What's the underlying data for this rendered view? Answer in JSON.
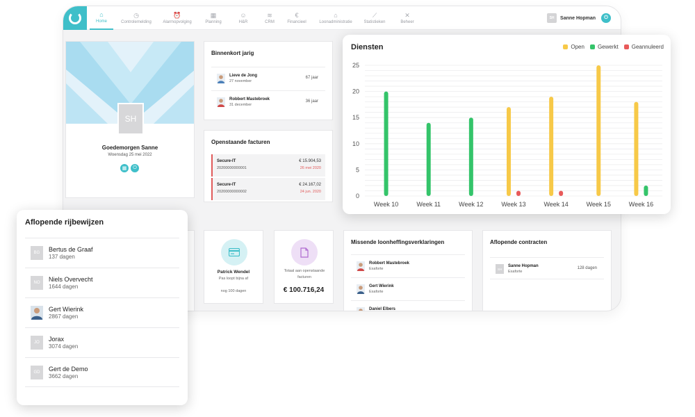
{
  "app": {
    "user_initials": "SH",
    "user_name": "Sanne Hopman",
    "accent_color": "#3fbfc9"
  },
  "nav": [
    {
      "label": "Home",
      "icon": "home-icon",
      "glyph": "⌂",
      "active": true
    },
    {
      "label": "Controlemelding",
      "icon": "clock-icon",
      "glyph": "◷"
    },
    {
      "label": "Alarmopvolging",
      "icon": "alarm-icon",
      "glyph": "⏰"
    },
    {
      "label": "Planning",
      "icon": "calendar-icon",
      "glyph": "▦"
    },
    {
      "label": "H&R",
      "icon": "people-icon",
      "glyph": "☺"
    },
    {
      "label": "CRM",
      "icon": "handshake-icon",
      "glyph": "≋"
    },
    {
      "label": "Financieel",
      "icon": "euro-icon",
      "glyph": "€"
    },
    {
      "label": "Loonadministratie",
      "icon": "bank-icon",
      "glyph": "⌂"
    },
    {
      "label": "Statistieken",
      "icon": "chart-icon",
      "glyph": "⟋"
    },
    {
      "label": "Beheer",
      "icon": "tools-icon",
      "glyph": "✕"
    }
  ],
  "welcome": {
    "initials": "SH",
    "greeting": "Goedemorgen Sanne",
    "date": "Woensdag 25 mei 2022"
  },
  "birthdays": {
    "title": "Binnenkort jarig",
    "items": [
      {
        "name": "Lieve de Jong",
        "date": "27 november",
        "age": "67 jaar"
      },
      {
        "name": "Robbert Mastebroek",
        "date": "31 december",
        "age": "36 jaar"
      }
    ]
  },
  "invoices": {
    "title": "Openstaande facturen",
    "items": [
      {
        "company": "Secure-IT",
        "number": "20200000000001",
        "amount": "€ 15.904,53",
        "due": "26 mei 2020"
      },
      {
        "company": "Secure-IT",
        "number": "20200000000002",
        "amount": "€ 24.167,02",
        "due": "24 jun. 2020"
      }
    ]
  },
  "pass_card": {
    "name": "Patrick Wendel",
    "line1": "Pas loopt bijna af",
    "line2": "nog 100 dagen"
  },
  "total_card": {
    "description": "Totaal aan openstaande facturen",
    "amount": "€ 100.716,24"
  },
  "missing": {
    "title": "Missende loonheffingsverklaringen",
    "items": [
      {
        "name": "Robbert Mastebroek",
        "org": "Exaforte"
      },
      {
        "name": "Gert Wierink",
        "org": "Exaforte"
      },
      {
        "name": "Daniel Elbers",
        "org": ""
      }
    ]
  },
  "contracts": {
    "title": "Aflopende contracten",
    "items": [
      {
        "initials": "SH",
        "name": "Sanne Hopman",
        "org": "Exaforte",
        "days": "128 dagen"
      }
    ]
  },
  "licenses": {
    "title": "Aflopende rijbewijzen",
    "items": [
      {
        "initials": "BG",
        "name": "Bertus de Graaf",
        "days": "137 dagen",
        "photo": false
      },
      {
        "initials": "NO",
        "name": "Niels Overvecht",
        "days": "1644 dagen",
        "photo": false
      },
      {
        "initials": "",
        "name": "Gert Wierink",
        "days": "2867 dagen",
        "photo": true
      },
      {
        "initials": "JO",
        "name": "Jorax",
        "days": "3074 dagen",
        "photo": false
      },
      {
        "initials": "GD",
        "name": "Gert de Demo",
        "days": "3662 dagen",
        "photo": false
      }
    ]
  },
  "chart_data": {
    "type": "bar",
    "title": "Diensten",
    "categories": [
      "Week 10",
      "Week 11",
      "Week 12",
      "Week 13",
      "Week 14",
      "Week 15",
      "Week 16"
    ],
    "series": [
      {
        "name": "Open",
        "color": "#f7c948",
        "values": [
          0,
          0,
          0,
          17,
          19,
          25,
          18
        ]
      },
      {
        "name": "Gewerkt",
        "color": "#34c46a",
        "values": [
          20,
          14,
          15,
          0,
          0,
          0,
          2
        ]
      },
      {
        "name": "Geannuleerd",
        "color": "#e85a5a",
        "values": [
          0,
          0,
          0,
          1,
          1,
          0,
          0
        ]
      }
    ],
    "ylim": [
      0,
      25
    ],
    "yticks": [
      0,
      5,
      10,
      15,
      20,
      25
    ],
    "grid": true,
    "legend": "top-right"
  }
}
